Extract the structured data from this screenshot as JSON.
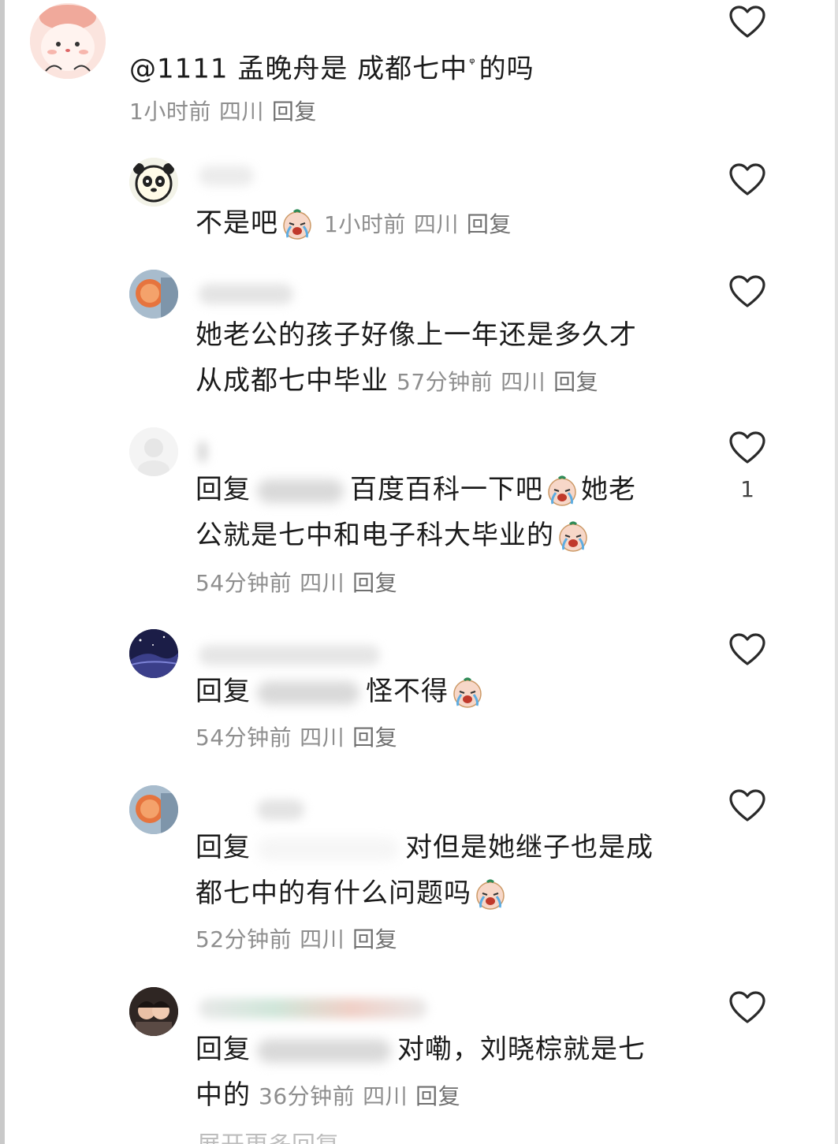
{
  "comments": [
    {
      "text_parts": [
        "@1111 孟晚舟是 成都七中",
        "的吗"
      ],
      "superscript": "ᵠ",
      "time": "1小时前",
      "location": "四川",
      "reply_label": "回复"
    }
  ],
  "replies": [
    {
      "text": "不是吧",
      "emoji": "crying-face-emoji",
      "time": "1小时前",
      "location": "四川",
      "reply_label": "回复"
    },
    {
      "line1": "她老公的孩子好像上一年还是多久才",
      "line2": "从成都七中毕业",
      "time": "57分钟前",
      "location": "四川",
      "reply_label": "回复"
    },
    {
      "prefix": "回复",
      "line1_after": "百度百科一下吧",
      "line1_tail": "她老",
      "line2": "公就是七中和电子科大毕业的",
      "time": "54分钟前",
      "location": "四川",
      "reply_label": "回复",
      "like_count": "1"
    },
    {
      "prefix": "回复",
      "text": "怪不得",
      "time": "54分钟前",
      "location": "四川",
      "reply_label": "回复"
    },
    {
      "prefix": "回复",
      "line1_after": "对但是她继子也是成",
      "line2": "都七中的有什么问题吗",
      "time": "52分钟前",
      "location": "四川",
      "reply_label": "回复"
    },
    {
      "prefix": "回复",
      "line1_after": "对嘞，刘晓棕就是七",
      "line2": "中的",
      "time": "36分钟前",
      "location": "四川",
      "reply_label": "回复"
    }
  ],
  "more_replies_peek": "展开更多回复",
  "icons": {
    "like": "heart-outline-icon",
    "emoji": "crying-face-emoji"
  },
  "colors": {
    "meta_text": "#8e8e8e",
    "body_text": "#1b1b1b",
    "heart_stroke": "#2a2a2a"
  }
}
